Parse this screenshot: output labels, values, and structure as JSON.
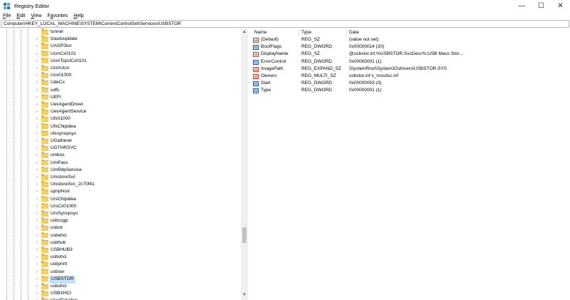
{
  "window": {
    "title": "Registry Editor",
    "controls": {
      "minimize": "—",
      "maximize": "☐",
      "close": "✕"
    }
  },
  "menu": [
    {
      "pre": "",
      "key": "F",
      "post": "ile"
    },
    {
      "pre": "",
      "key": "E",
      "post": "dit"
    },
    {
      "pre": "",
      "key": "V",
      "post": "iew"
    },
    {
      "pre": "F",
      "key": "a",
      "post": "vorites"
    },
    {
      "pre": "",
      "key": "H",
      "post": "elp"
    }
  ],
  "address": "Computer\\HKEY_LOCAL_MACHINE\\SYSTEM\\CurrentControlSet\\Services\\USBSTOR",
  "tree": {
    "items": [
      {
        "label": "tunnel",
        "expandable": false
      },
      {
        "label": "tzautoupdate",
        "expandable": true
      },
      {
        "label": "UASPStor",
        "expandable": true
      },
      {
        "label": "UcmCx0101",
        "expandable": true
      },
      {
        "label": "UcmTcpciCx0101",
        "expandable": true
      },
      {
        "label": "UcmUcsi",
        "expandable": true
      },
      {
        "label": "Ucx01000",
        "expandable": true
      },
      {
        "label": "UdeCx",
        "expandable": true
      },
      {
        "label": "udfs",
        "expandable": true
      },
      {
        "label": "UEFI",
        "expandable": true
      },
      {
        "label": "UevAgentDriver",
        "expandable": true
      },
      {
        "label": "UevAgentService",
        "expandable": true
      },
      {
        "label": "Ufx01000",
        "expandable": true
      },
      {
        "label": "UfxChipidea",
        "expandable": true
      },
      {
        "label": "ufxsynopsys",
        "expandable": true
      },
      {
        "label": "UGatherer",
        "expandable": true
      },
      {
        "label": "UGTHRSVC",
        "expandable": true
      },
      {
        "label": "umbus",
        "expandable": true
      },
      {
        "label": "UmPass",
        "expandable": true
      },
      {
        "label": "UmRdpService",
        "expandable": true
      },
      {
        "label": "UnistoreSvc",
        "expandable": true
      },
      {
        "label": "UnistoreSvc_2c70f41",
        "expandable": true
      },
      {
        "label": "upnphost",
        "expandable": true
      },
      {
        "label": "UrsChipidea",
        "expandable": true
      },
      {
        "label": "UrsCx01000",
        "expandable": true
      },
      {
        "label": "UrsSynopsys",
        "expandable": true
      },
      {
        "label": "usbccgp",
        "expandable": true
      },
      {
        "label": "usbcir",
        "expandable": true
      },
      {
        "label": "usbehci",
        "expandable": true
      },
      {
        "label": "usbhub",
        "expandable": true
      },
      {
        "label": "USBHUB3",
        "expandable": true
      },
      {
        "label": "usbohci",
        "expandable": true
      },
      {
        "label": "usbprint",
        "expandable": true
      },
      {
        "label": "usbser",
        "expandable": true
      },
      {
        "label": "USBSTOR",
        "expandable": true,
        "selected": true
      },
      {
        "label": "usbuhci",
        "expandable": true
      },
      {
        "label": "USBXHCI",
        "expandable": true
      },
      {
        "label": "UserDataSvc",
        "expandable": true
      }
    ],
    "scroll_up": "▲",
    "scroll_down": "▼",
    "collapsed_glyph": "›"
  },
  "list": {
    "headers": {
      "name": "Name",
      "type": "Type",
      "data": "Data"
    },
    "rows": [
      {
        "name": "(Default)",
        "type": "REG_SZ",
        "data": "(value not set)",
        "icon": "string-value-icon"
      },
      {
        "name": "BootFlags",
        "type": "REG_DWORD",
        "data": "0x00000014 (20)",
        "icon": "binary-value-icon"
      },
      {
        "name": "DisplayName",
        "type": "REG_SZ",
        "data": "@usbstor.inf,%USBSTOR.SvcDesc%;USB Mass Stor...",
        "icon": "string-value-icon"
      },
      {
        "name": "ErrorControl",
        "type": "REG_DWORD",
        "data": "0x00000001 (1)",
        "icon": "binary-value-icon"
      },
      {
        "name": "ImagePath",
        "type": "REG_EXPAND_SZ",
        "data": "\\SystemRoot\\System32\\drivers\\USBSTOR.SYS",
        "icon": "string-value-icon"
      },
      {
        "name": "Owners",
        "type": "REG_MULTI_SZ",
        "data": "usbstor.inf v_mscdsc.inf",
        "icon": "string-value-icon"
      },
      {
        "name": "Start",
        "type": "REG_DWORD",
        "data": "0x00000003 (3)",
        "icon": "binary-value-icon"
      },
      {
        "name": "Type",
        "type": "REG_DWORD",
        "data": "0x00000001 (1)",
        "icon": "binary-value-icon"
      }
    ]
  }
}
